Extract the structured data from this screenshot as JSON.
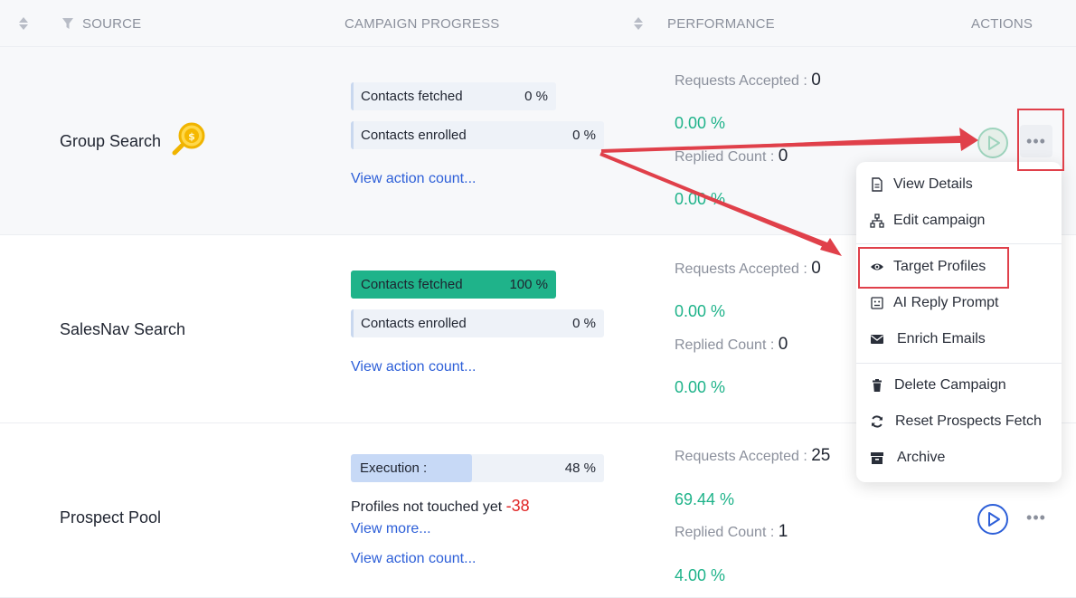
{
  "header": {
    "source": "SOURCE",
    "campaign_progress": "CAMPAIGN PROGRESS",
    "performance": "PERFORMANCE",
    "actions": "ACTIONS"
  },
  "rows": [
    {
      "source": "Group Search",
      "progress": [
        {
          "label": "Contacts fetched",
          "value": "0 %"
        },
        {
          "label": "Contacts enrolled",
          "value": "0 %"
        }
      ],
      "action_link": "View action count...",
      "requests_label": "Requests Accepted :",
      "requests_value": "0",
      "requests_pct": "0.00 %",
      "replied_label": "Replied Count :",
      "replied_value": "0",
      "replied_pct": "0.00 %"
    },
    {
      "source": "SalesNav Search",
      "progress": [
        {
          "label": "Contacts fetched",
          "value": "100 %"
        },
        {
          "label": "Contacts enrolled",
          "value": "0 %"
        }
      ],
      "action_link": "View action count...",
      "requests_label": "Requests Accepted :",
      "requests_value": "0",
      "requests_pct": "0.00 %",
      "replied_label": "Replied Count :",
      "replied_value": "0",
      "replied_pct": "0.00 %"
    },
    {
      "source": "Prospect Pool",
      "execution_label": "Execution :",
      "execution_value": "48 %",
      "execution_fraction": 0.48,
      "untouched_label": "Profiles not touched yet",
      "untouched_value": "-38",
      "view_more": "View more...",
      "action_link": "View action count...",
      "requests_label": "Requests Accepted :",
      "requests_value": "25",
      "requests_pct": "69.44 %",
      "replied_label": "Replied Count :",
      "replied_value": "1",
      "replied_pct": "4.00 %"
    }
  ],
  "menu": {
    "view_details": "View Details",
    "edit_campaign": "Edit campaign",
    "target_profiles": "Target Profiles",
    "ai_reply_prompt": "AI Reply Prompt",
    "enrich_emails": "Enrich Emails",
    "delete_campaign": "Delete Campaign",
    "reset_prospects_fetch": "Reset Prospects Fetch",
    "archive": "Archive"
  },
  "colors": {
    "accent_green": "#1fb38a",
    "link_blue": "#2d5fd8",
    "annotation_red": "#e0404a"
  },
  "icons": [
    "sort-icon",
    "filter-icon",
    "search-coin-icon",
    "play-icon",
    "more-icon",
    "document-icon",
    "sitemap-icon",
    "eye-icon",
    "robot-icon",
    "envelope-icon",
    "trash-icon",
    "refresh-icon",
    "archive-icon"
  ]
}
